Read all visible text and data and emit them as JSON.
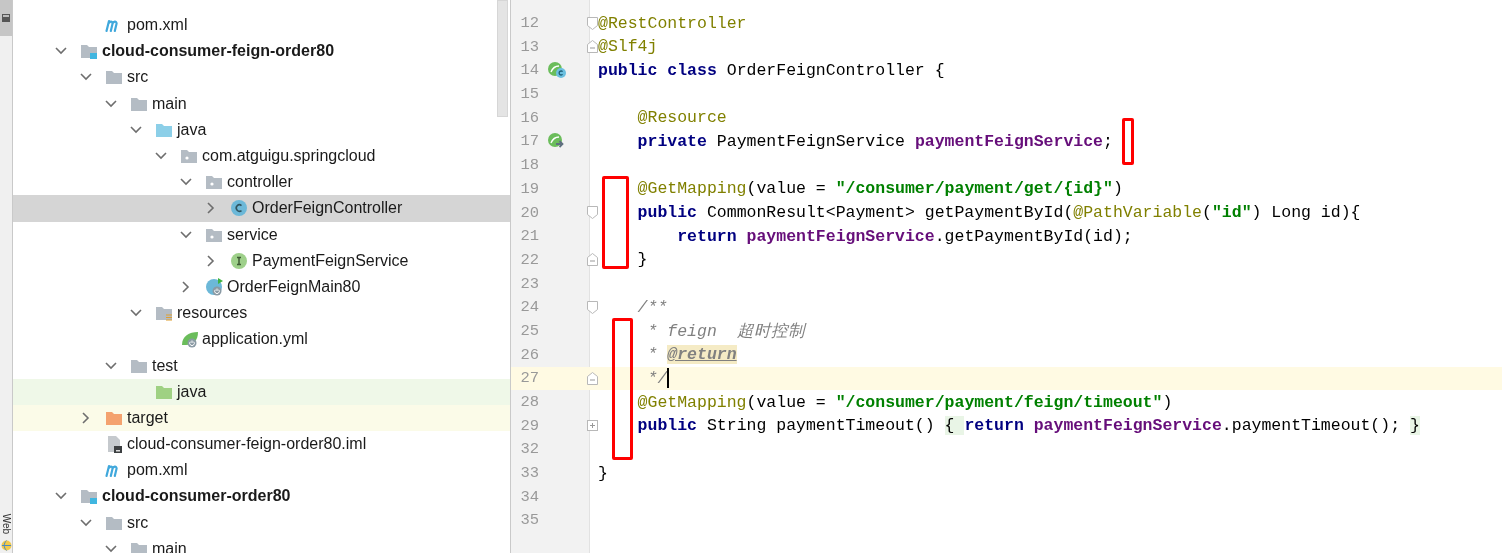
{
  "side_stripe": {
    "label": "Web"
  },
  "project_tree": {
    "continued_items": [
      {
        "label": "pom.xml",
        "kind": "maven-file",
        "selected": false
      }
    ],
    "items": [
      {
        "label": "cloud-consumer-feign-order80",
        "kind": "module",
        "expanded": true,
        "selected": false,
        "children": [
          {
            "label": "src",
            "kind": "folder",
            "expanded": true,
            "selected": false,
            "children": [
              {
                "label": "main",
                "kind": "folder",
                "expanded": true,
                "selected": false,
                "children": [
                  {
                    "label": "java",
                    "kind": "source-root",
                    "expanded": true,
                    "selected": false,
                    "children": [
                      {
                        "label": "com.atguigu.springcloud",
                        "kind": "package",
                        "expanded": true,
                        "selected": false,
                        "children": [
                          {
                            "label": "controller",
                            "kind": "package",
                            "expanded": true,
                            "selected": false,
                            "children": [
                              {
                                "label": "OrderFeignController",
                                "kind": "class",
                                "expanded": false,
                                "selected": true
                              }
                            ]
                          },
                          {
                            "label": "service",
                            "kind": "package",
                            "expanded": true,
                            "selected": false,
                            "children": [
                              {
                                "label": "PaymentFeignService",
                                "kind": "interface",
                                "expanded": false,
                                "selected": false
                              }
                            ]
                          },
                          {
                            "label": "OrderFeignMain80",
                            "kind": "boot-class",
                            "expanded": false,
                            "selected": false
                          }
                        ]
                      }
                    ]
                  },
                  {
                    "label": "resources",
                    "kind": "resources-root",
                    "expanded": true,
                    "selected": false,
                    "children": [
                      {
                        "label": "application.yml",
                        "kind": "yml-file",
                        "selected": false
                      }
                    ]
                  }
                ]
              },
              {
                "label": "test",
                "kind": "folder",
                "expanded": true,
                "selected": false,
                "children": [
                  {
                    "label": "java",
                    "kind": "test-root",
                    "selected": false
                  }
                ]
              }
            ]
          },
          {
            "label": "target",
            "kind": "excluded-folder",
            "expanded": false,
            "selected": false
          },
          {
            "label": "cloud-consumer-feign-order80.iml",
            "kind": "iml-file",
            "selected": false
          },
          {
            "label": "pom.xml",
            "kind": "maven-file",
            "selected": false
          }
        ]
      },
      {
        "label": "cloud-consumer-order80",
        "kind": "module",
        "expanded": true,
        "selected": false,
        "children": [
          {
            "label": "src",
            "kind": "folder",
            "expanded": true,
            "selected": false,
            "children": [
              {
                "label": "main",
                "kind": "folder",
                "expanded": true,
                "selected": false
              }
            ]
          }
        ]
      }
    ]
  },
  "editor": {
    "lines": [
      {
        "number": "12",
        "current": false,
        "fold": {
          "kind": "start"
        },
        "tokens": [
          {
            "kind": "annotation",
            "text": "@RestController"
          }
        ]
      },
      {
        "number": "13",
        "current": false,
        "fold": {
          "kind": "end"
        },
        "tokens": [
          {
            "kind": "annotation",
            "text": "@Slf4j"
          }
        ]
      },
      {
        "number": "14",
        "current": false,
        "gutter_icon": {
          "kind": "bean-class"
        },
        "tokens": [
          {
            "kind": "keyword",
            "text": "public class "
          },
          {
            "kind": "plain",
            "text": "OrderFeignController {"
          }
        ]
      },
      {
        "number": "15",
        "current": false
      },
      {
        "number": "16",
        "current": false,
        "tokens": [
          {
            "kind": "annotation",
            "text": "    @Resource"
          }
        ]
      },
      {
        "number": "17",
        "current": false,
        "gutter_icon": {
          "kind": "injected-bean"
        },
        "tokens": [
          {
            "kind": "keyword",
            "text": "    private "
          },
          {
            "kind": "plain",
            "text": "PaymentFeignService "
          },
          {
            "kind": "field",
            "text": "paymentFeignService"
          },
          {
            "kind": "plain",
            "text": ";"
          }
        ]
      },
      {
        "number": "18",
        "current": false
      },
      {
        "number": "19",
        "current": false,
        "tokens": [
          {
            "kind": "annotation",
            "text": "    @GetMapping"
          },
          {
            "kind": "plain",
            "text": "(value = "
          },
          {
            "kind": "string",
            "text": "\"/consumer/payment/get/{id}\""
          },
          {
            "kind": "plain",
            "text": ")"
          }
        ]
      },
      {
        "number": "20",
        "current": false,
        "fold": {
          "kind": "start"
        },
        "tokens": [
          {
            "kind": "keyword",
            "text": "    public "
          },
          {
            "kind": "plain",
            "text": "CommonResult<Payment> getPaymentById("
          },
          {
            "kind": "annotation",
            "text": "@PathVariable"
          },
          {
            "kind": "plain",
            "text": "("
          },
          {
            "kind": "string",
            "text": "\"id\""
          },
          {
            "kind": "plain",
            "text": ") Long id){"
          }
        ]
      },
      {
        "number": "21",
        "current": false,
        "tokens": [
          {
            "kind": "keyword",
            "text": "        return "
          },
          {
            "kind": "field",
            "text": "paymentFeignService"
          },
          {
            "kind": "plain",
            "text": ".getPaymentById(id);"
          }
        ]
      },
      {
        "number": "22",
        "current": false,
        "fold": {
          "kind": "end"
        },
        "tokens": [
          {
            "kind": "plain",
            "text": "    }"
          }
        ]
      },
      {
        "number": "23",
        "current": false
      },
      {
        "number": "24",
        "current": false,
        "fold": {
          "kind": "start"
        },
        "tokens": [
          {
            "kind": "comment",
            "text": "    /**"
          }
        ]
      },
      {
        "number": "25",
        "current": false,
        "tokens": [
          {
            "kind": "comment",
            "text": "     * feign  超时控制"
          }
        ]
      },
      {
        "number": "26",
        "current": false,
        "tokens": [
          {
            "kind": "comment",
            "text": "     * "
          },
          {
            "kind": "doc-tag",
            "text": "@return"
          }
        ]
      },
      {
        "number": "27",
        "current": true,
        "fold": {
          "kind": "end"
        },
        "tokens": [
          {
            "kind": "comment",
            "text": "     */"
          }
        ]
      },
      {
        "number": "28",
        "current": false,
        "tokens": [
          {
            "kind": "annotation",
            "text": "    @GetMapping"
          },
          {
            "kind": "plain",
            "text": "(value = "
          },
          {
            "kind": "string",
            "text": "\"/consumer/payment/feign/timeout\""
          },
          {
            "kind": "plain",
            "text": ")"
          }
        ]
      },
      {
        "number": "29",
        "current": false,
        "fold": {
          "kind": "folded"
        },
        "tokens": [
          {
            "kind": "keyword",
            "text": "    public "
          },
          {
            "kind": "plain",
            "text": "String paymentTimeout() "
          },
          {
            "kind": "fold-brace",
            "text": "{ "
          },
          {
            "kind": "keyword",
            "text": "return "
          },
          {
            "kind": "field",
            "text": "paymentFeignService"
          },
          {
            "kind": "plain",
            "text": ".paymentTimeout(); "
          },
          {
            "kind": "fold-brace",
            "text": "}"
          }
        ]
      },
      {
        "number": "32",
        "current": false
      },
      {
        "number": "33",
        "current": false,
        "tokens": [
          {
            "kind": "plain",
            "text": "}"
          }
        ]
      },
      {
        "number": "34",
        "current": false
      },
      {
        "number": "35",
        "current": false
      }
    ]
  }
}
